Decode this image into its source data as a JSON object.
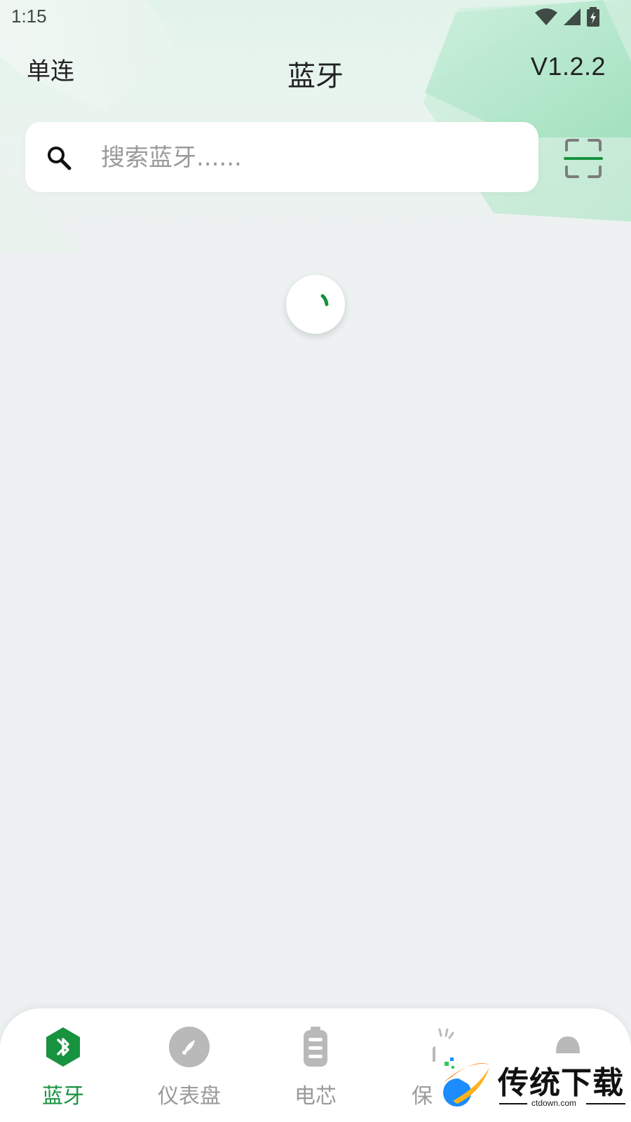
{
  "theme": {
    "primary": "#17923f",
    "background": "#edf1f1",
    "inactive": "#9a9a9a"
  },
  "status_bar": {
    "time": "1:15",
    "icons": [
      "wifi-icon",
      "signal-icon",
      "battery-charging-icon"
    ]
  },
  "header": {
    "left_action": "单连",
    "title": "蓝牙",
    "version": "V1.2.2"
  },
  "search": {
    "placeholder": "搜索蓝牙......",
    "value": "",
    "icon": "search-icon",
    "scan_icon": "scan-icon"
  },
  "loading": {
    "icon": "loading-spinner"
  },
  "bottom_nav": {
    "items": [
      {
        "label": "蓝牙",
        "icon": "bluetooth-icon",
        "active": true
      },
      {
        "label": "仪表盘",
        "icon": "dashboard-icon",
        "active": false
      },
      {
        "label": "电芯",
        "icon": "battery-cell-icon",
        "active": false
      },
      {
        "label": "保",
        "icon": "protection-icon",
        "active": false
      },
      {
        "label": "",
        "icon": "profile-icon",
        "active": false
      }
    ]
  },
  "watermark": {
    "text": "传统下载",
    "domain": "ctdown.com"
  }
}
